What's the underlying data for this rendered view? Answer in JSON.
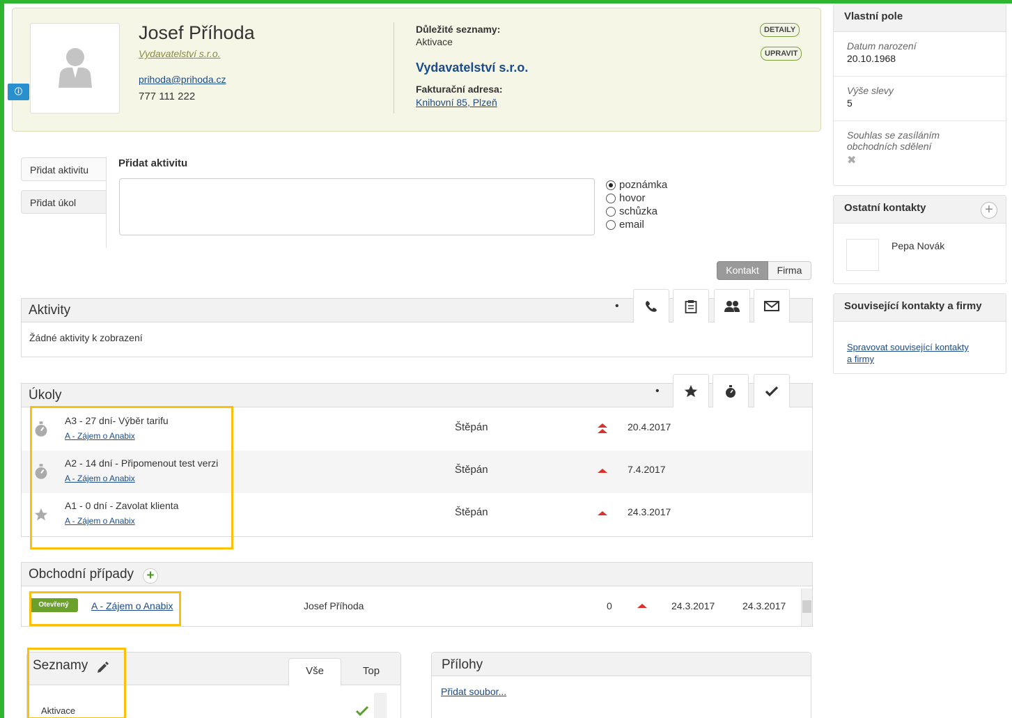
{
  "contact": {
    "name": "Josef Příhoda",
    "company": "Vydavatelství s.r.o.",
    "email": "prihoda@prihoda.cz",
    "phone": "777 111 222",
    "important_lists_label": "Důležité seznamy:",
    "important_lists_value": "Aktivace",
    "company_title": "Vydavatelství s.r.o.",
    "billing_label": "Fakturační adresa:",
    "billing_address": "Knihovní 85, Plzeň",
    "detail_button": "DETAILY",
    "edit_button": "UPRAVIT"
  },
  "sidebar": {
    "custom_fields": {
      "title": "Vlastní pole",
      "fields": [
        {
          "label": "Datum narození",
          "value": "20.10.1968"
        },
        {
          "label": "Výše slevy",
          "value": "5"
        },
        {
          "label": "Souhlas se zasíláním obchodních sdělení",
          "value": "✖"
        }
      ]
    },
    "other_contacts": {
      "title": "Ostatní kontakty",
      "contact_name": "Pepa Novák"
    },
    "related": {
      "title": "Související kontakty a firmy",
      "link_line1": "Spravovat související kontakty",
      "link_line2": "a firmy"
    }
  },
  "activity_form": {
    "tab_add_activity": "Přidat aktivitu",
    "tab_add_task": "Přidat úkol",
    "heading": "Přidat aktivitu",
    "textarea_value": "",
    "types": [
      "poznámka",
      "hovor",
      "schůzka",
      "email"
    ],
    "selected_type": "poznámka",
    "toggle_contact": "Kontakt",
    "toggle_company": "Firma"
  },
  "activities": {
    "title": "Aktivity",
    "empty": "Žádné aktivity k zobrazení"
  },
  "tasks": {
    "title": "Úkoly",
    "rows": [
      {
        "title": "A3 - 27 dní- Výběr tarifu",
        "link": "A - Zájem o Anabix",
        "owner": "Štěpán",
        "date": "20.4.2017"
      },
      {
        "title": "A2 - 14 dní - Připomenout test verzi",
        "link": "A - Zájem o Anabix",
        "owner": "Štěpán",
        "date": "7.4.2017"
      },
      {
        "title": "A1 - 0 dní - Zavolat klienta",
        "link": "A - Zájem o Anabix",
        "owner": "Štěpán",
        "date": "24.3.2017"
      }
    ]
  },
  "deals": {
    "title": "Obchodní případy",
    "status": "Otevřený",
    "name": "A - Zájem o Anabix",
    "owner": "Josef Příhoda",
    "amount": "0",
    "date1": "24.3.2017",
    "date2": "24.3.2017"
  },
  "lists": {
    "title": "Seznamy",
    "tab_all": "Vše",
    "tab_top": "Top",
    "item": "Aktivace"
  },
  "attachments": {
    "title": "Přílohy",
    "add_file": "Přidat soubor..."
  },
  "colors": {
    "accent_green": "#2fb52f",
    "highlight": "#fcc00a",
    "priority_red": "#d9312b",
    "status_green": "#6aa12a"
  }
}
